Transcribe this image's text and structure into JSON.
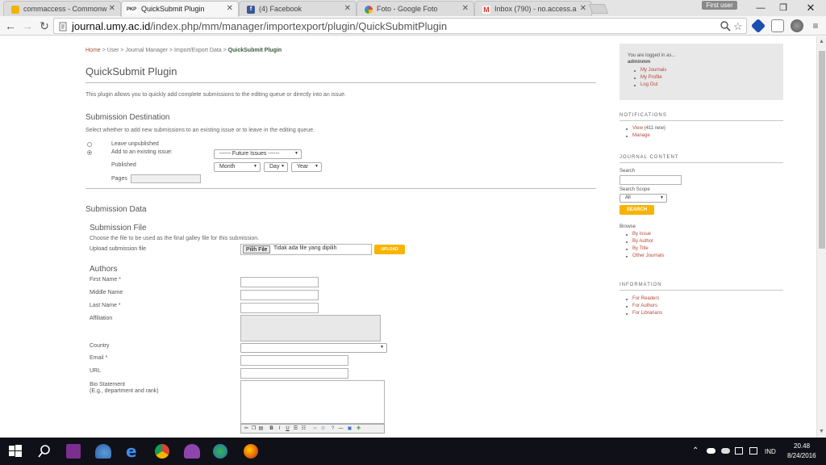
{
  "browser": {
    "tabs": [
      {
        "title": "commaccess - Commonw",
        "fav_color": "#f0b400"
      },
      {
        "title": "QuickSubmit Plugin",
        "fav_text": "PKP",
        "fav_color": "#666666"
      },
      {
        "title": "(4) Facebook",
        "fav_color": "#3b5998"
      },
      {
        "title": "Foto - Google Foto",
        "fav_color": "#e94235"
      },
      {
        "title": "Inbox (790) - no.access.a",
        "fav_color": "#d93025"
      }
    ],
    "user_badge": "First user",
    "url_host": "journal.umy.ac.id",
    "url_path": "/index.php/mm/manager/importexport/plugin/QuickSubmitPlugin"
  },
  "breadcrumb": {
    "items": [
      "Home",
      "User",
      "Journal Manager",
      "Import/Export Data"
    ],
    "separator": " > ",
    "current": "QuickSubmit Plugin"
  },
  "page": {
    "title": "QuickSubmit Plugin",
    "intro": "This plugin allows you to quickly add complete submissions to the editing queue or directly into an issue.",
    "destination": {
      "heading": "Submission Destination",
      "help": "Select whether to add new submissions to an existing issue or to leave in the editing queue.",
      "opt_unpublished": "Leave unpublished",
      "opt_existing": "Add to an existing issue:",
      "issue_select": "------ Future Issues ------",
      "published_label": "Published",
      "month": "Month",
      "day": "Day",
      "year": "Year",
      "pages_label": "Pages"
    },
    "data": {
      "heading": "Submission Data",
      "file_heading": "Submission File",
      "file_help": "Choose the file to be used as the final galley file for this submission.",
      "upload_label": "Upload submission file",
      "choose_btn": "Pilih File",
      "no_file": "Tidak ada file yang dipilih",
      "upload_btn": "UPLOAD",
      "authors_heading": "Authors",
      "first_name": "First Name *",
      "middle_name": "Middle Name",
      "last_name": "Last Name *",
      "affiliation": "Affiliation",
      "country": "Country",
      "email": "Email *",
      "url": "URL",
      "bio": "Bio Statement",
      "bio_hint": "(E.g., department and rank)"
    }
  },
  "sidebar": {
    "logged_in": "You are logged in as...",
    "username": "adminmm",
    "user_links": [
      "My Journals",
      "My Profile",
      "Log Out"
    ],
    "notifications_heading": "NOTIFICATIONS",
    "notifications_view": "View",
    "notifications_count": "(411 new)",
    "notifications_manage": "Manage",
    "content_heading": "JOURNAL CONTENT",
    "search_label": "Search",
    "scope_label": "Search Scope",
    "scope_value": "All",
    "search_btn": "SEARCH",
    "browse_label": "Browse",
    "browse_links": [
      "By Issue",
      "By Author",
      "By Title",
      "Other Journals"
    ],
    "info_heading": "INFORMATION",
    "info_links": [
      "For Readers",
      "For Authors",
      "For Librarians"
    ]
  },
  "taskbar": {
    "lang": "IND",
    "time": "20.48",
    "date": "8/24/2016"
  }
}
